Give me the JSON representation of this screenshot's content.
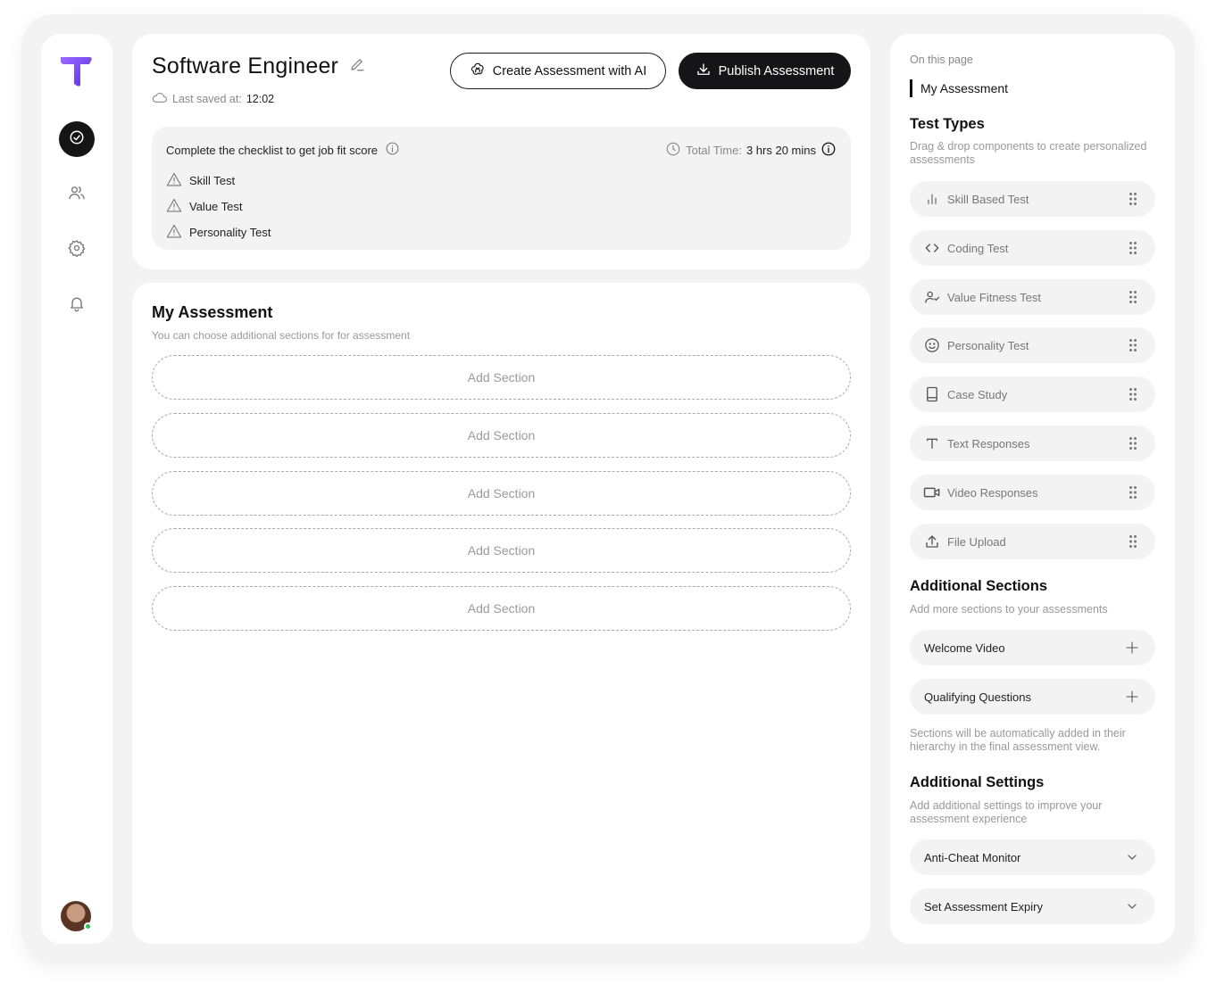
{
  "header": {
    "title": "Software Engineer",
    "saved_prefix": "Last saved at:",
    "saved_time": "12:02",
    "create_ai_label": "Create Assessment with AI",
    "publish_label": "Publish Assessment"
  },
  "checklist": {
    "heading": "Complete the checklist to get job fit score",
    "total_time_label": "Total Time:",
    "total_time_value": "3 hrs 20 mins",
    "items": [
      "Skill Test",
      "Value Test",
      "Personality Test"
    ]
  },
  "assessment": {
    "title": "My Assessment",
    "subtitle": "You can choose additional sections for for assessment",
    "slots": [
      "Add Section",
      "Add Section",
      "Add Section",
      "Add Section",
      "Add Section"
    ]
  },
  "right_panel": {
    "on_this_page": "On this page",
    "anchor": "My Assessment",
    "test_types": {
      "title": "Test Types",
      "description": "Drag & drop components to create personalized assessments",
      "items": [
        {
          "label": "Skill Based Test",
          "icon": "bar-chart-icon"
        },
        {
          "label": "Coding Test",
          "icon": "code-icon"
        },
        {
          "label": "Value Fitness Test",
          "icon": "user-check-icon"
        },
        {
          "label": "Personality Test",
          "icon": "smile-icon"
        },
        {
          "label": "Case Study",
          "icon": "book-icon"
        },
        {
          "label": "Text Responses",
          "icon": "text-icon"
        },
        {
          "label": "Video Responses",
          "icon": "video-icon"
        },
        {
          "label": "File Upload",
          "icon": "upload-icon"
        }
      ]
    },
    "additional_sections": {
      "title": "Additional Sections",
      "description": "Add more sections to your assessments",
      "items": [
        "Welcome Video",
        "Qualifying Questions"
      ],
      "note": "Sections will be automatically added in their hierarchy in the final assessment view."
    },
    "additional_settings": {
      "title": "Additional Settings",
      "description": "Add additional settings to improve your assessment experience",
      "items": [
        "Anti-Cheat Monitor",
        "Set Assessment Expiry"
      ]
    }
  },
  "colors": {
    "accent_purple": "#7c4dff",
    "dark": "#151518",
    "online": "#2fbf4f"
  }
}
